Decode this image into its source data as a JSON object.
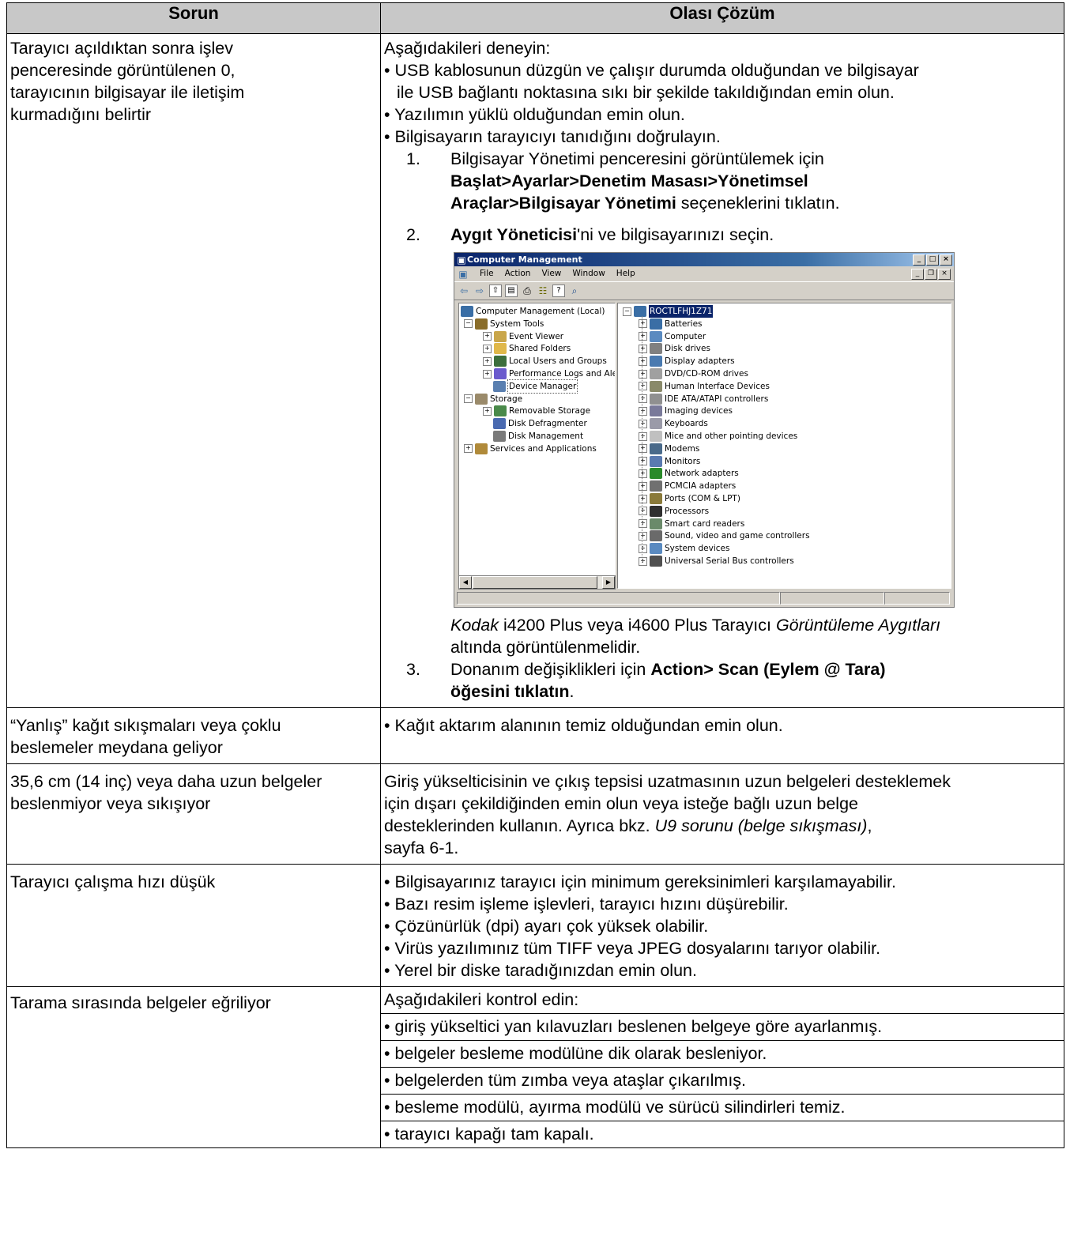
{
  "table": {
    "headers": [
      "Sorun",
      "Olası Çözüm"
    ],
    "row1": {
      "problem": [
        "Tarayıcı açıldıktan sonra işlev",
        "penceresinde görüntülenen 0,",
        "tarayıcının bilgisayar ile iletişim",
        "kurmadığını belirtir"
      ],
      "intro": "Aşağıdakileri deneyin:",
      "b1_l1": "• USB kablosunun düzgün ve çalışır durumda olduğundan ve bilgisayar",
      "b1_l2": "ile USB bağlantı noktasına sıkı bir şekilde takıldığından emin olun.",
      "b2": "• Yazılımın yüklü olduğundan emin olun.",
      "b3": "• Bilgisayarın tarayıcıyı tanıdığını doğrulayın.",
      "s1_num": "1.",
      "s1_l1": "Bilgisayar Yönetimi penceresini görüntülemek için",
      "s1_bold1": "Başlat>Ayarlar>Denetim Masası>Yönetimsel",
      "s1_bold2": "Araçlar>Bilgisayar Yönetimi",
      "s1_rest": " seçeneklerini tıklatın.",
      "s2_num": "2.",
      "s2_bold": "Aygıt Yöneticisi",
      "s2_rest": "'ni ve bilgisayarınızı seçin.",
      "after_italic1": "Kodak",
      "after_mid": " i4200 Plus veya i4600 Plus Tarayıcı ",
      "after_italic2": "Görüntüleme Aygıtları",
      "after_l2": "altında görüntülenmelidir.",
      "s3_num": "3.",
      "s3_pre": "Donanım değişiklikleri için ",
      "s3_bold1": "Action> Scan (Eylem @ Tara)",
      "s3_bold2": "öğesini tıklatın",
      "s3_end": "."
    },
    "row2": {
      "problem": [
        "“Yanlış” kağıt sıkışmaları veya çoklu",
        "beslemeler meydana geliyor"
      ],
      "solution": "• Kağıt aktarım alanının temiz olduğundan emin olun."
    },
    "row3": {
      "problem": [
        "35,6 cm (14 inç) veya daha uzun belgeler",
        "beslenmiyor veya sıkışıyor"
      ],
      "l1": "Giriş yükselticisinin ve çıkış tepsisi uzatmasının uzun belgeleri desteklemek",
      "l2": "için dışarı çekildiğinden emin olun veya isteğe bağlı uzun belge",
      "l3_pre": "desteklerinden kullanın. Ayrıca bkz. ",
      "l3_italic": "U9 sorunu (belge sıkışması)",
      "l3_end": ",",
      "l4": "sayfa 6-1."
    },
    "row4": {
      "problem": [
        "Tarayıcı çalışma hızı düşük"
      ],
      "items": [
        "• Bilgisayarınız tarayıcı için minimum gereksinimleri karşılamayabilir.",
        "• Bazı resim işleme işlevleri, tarayıcı hızını düşürebilir.",
        "• Çözünürlük (dpi) ayarı çok yüksek olabilir.",
        "• Virüs yazılımınız tüm TIFF veya JPEG dosyalarını tarıyor olabilir.",
        "• Yerel bir diske taradığınızdan emin olun."
      ]
    },
    "row5": {
      "problem": [
        "Tarama sırasında belgeler eğriliyor"
      ],
      "items": [
        "Aşağıdakileri kontrol edin:",
        "• giriş yükseltici yan kılavuzları beslenen belgeye göre ayarlanmış.",
        "• belgeler besleme modülüne dik olarak besleniyor.",
        "• belgelerden tüm zımba veya ataşlar çıkarılmış.",
        "• besleme modülü, ayırma modülü ve sürücü silindirleri temiz.",
        "• tarayıcı kapağı tam kapalı."
      ]
    }
  },
  "screenshot": {
    "title": "Computer Management",
    "menu": [
      "File",
      "Action",
      "View",
      "Window",
      "Help"
    ],
    "left_tree": [
      {
        "label": "Computer Management (Local)",
        "pm": "",
        "icon": "#3a6ea5"
      },
      {
        "label": "System Tools",
        "pm": "−",
        "icon": "#8a6d2a"
      },
      {
        "label": "Event Viewer",
        "pm": "+",
        "icon": "#c9a64a"
      },
      {
        "label": "Shared Folders",
        "pm": "+",
        "icon": "#e0b84a"
      },
      {
        "label": "Local Users and Groups",
        "pm": "+",
        "icon": "#3c6e3c"
      },
      {
        "label": "Performance Logs and Alerts",
        "pm": "+",
        "icon": "#6a5acd"
      },
      {
        "label": "Device Manager",
        "pm": "",
        "icon": "#5a7fb0"
      },
      {
        "label": "Storage",
        "pm": "−",
        "icon": "#9a8a6a"
      },
      {
        "label": "Removable Storage",
        "pm": "+",
        "icon": "#4a8a4a"
      },
      {
        "label": "Disk Defragmenter",
        "pm": "",
        "icon": "#4a6ab0"
      },
      {
        "label": "Disk Management",
        "pm": "",
        "icon": "#7a7a7a"
      },
      {
        "label": "Services and Applications",
        "pm": "+",
        "icon": "#b08a3a"
      }
    ],
    "computer_name": "ROCTLFHJ1Z71",
    "devices": [
      {
        "label": "Batteries",
        "icon": "#3a6ea5"
      },
      {
        "label": "Computer",
        "icon": "#5a8ac0"
      },
      {
        "label": "Disk drives",
        "icon": "#808080"
      },
      {
        "label": "Display adapters",
        "icon": "#4a7ab0"
      },
      {
        "label": "DVD/CD-ROM drives",
        "icon": "#a0a0a0"
      },
      {
        "label": "Human Interface Devices",
        "icon": "#8a8a6a"
      },
      {
        "label": "IDE ATA/ATAPI controllers",
        "icon": "#909090"
      },
      {
        "label": "Imaging devices",
        "icon": "#7a7a9a"
      },
      {
        "label": "Keyboards",
        "icon": "#9a9aa8"
      },
      {
        "label": "Mice and other pointing devices",
        "icon": "#c0c0c0"
      },
      {
        "label": "Modems",
        "icon": "#4a6a8a"
      },
      {
        "label": "Monitors",
        "icon": "#5a7ab0"
      },
      {
        "label": "Network adapters",
        "icon": "#2a8a2a"
      },
      {
        "label": "PCMCIA adapters",
        "icon": "#707070"
      },
      {
        "label": "Ports (COM & LPT)",
        "icon": "#8a7a3a"
      },
      {
        "label": "Processors",
        "icon": "#303030"
      },
      {
        "label": "Smart card readers",
        "icon": "#6a8a6a"
      },
      {
        "label": "Sound, video and game controllers",
        "icon": "#6a6a6a"
      },
      {
        "label": "System devices",
        "icon": "#5a8ac0"
      },
      {
        "label": "Universal Serial Bus controllers",
        "icon": "#505050"
      }
    ]
  }
}
